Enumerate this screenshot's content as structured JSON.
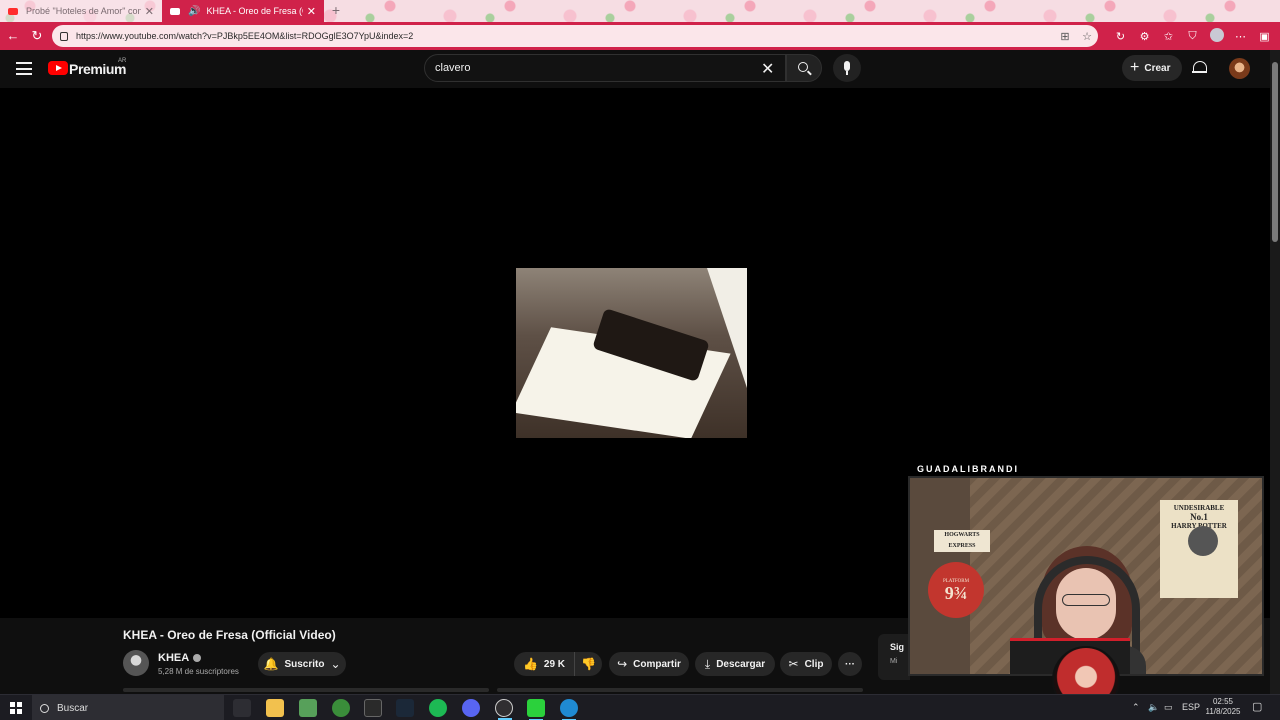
{
  "browser": {
    "tabs": [
      {
        "title": "Probé \"Hoteles de Amor\" con Pe",
        "active": false
      },
      {
        "title": "KHEA - Oreo de Fresa (Offic",
        "active": true
      }
    ],
    "new_tab": "+",
    "url": "https://www.youtube.com/watch?v=PJBkp5EE4OM&list=RDOGglE3O7YpU&index=2",
    "accent": "#d0224a"
  },
  "youtube": {
    "logo_text": "Premium",
    "country": "AR",
    "search_value": "clavero",
    "create_label": "Crear"
  },
  "video": {
    "title": "KHEA - Oreo de Fresa (Official Video)",
    "channel": "KHEA",
    "subscribers": "5,28 M de suscriptores",
    "subscribed_label": "Suscrito",
    "likes": "29 K",
    "share_label": "Compartir",
    "download_label": "Descargar",
    "clip_label": "Clip",
    "more_label": "···"
  },
  "sidebar_preview": {
    "title": "Sig",
    "subtitle": "Mi"
  },
  "overlay": {
    "streamer": "GUADALIBRANDI",
    "sign_text": "HOGWARTS EXPRESS",
    "platform_label": "PLATFORM",
    "platform_number": "9¾",
    "poster_top": "UNDESIRABLE",
    "poster_number": "No.1",
    "poster_name": "HARRY POTTER"
  },
  "taskbar": {
    "search_placeholder": "Buscar",
    "language": "ESP",
    "time": "02:55",
    "date": "11/8/2025",
    "apps": [
      "file-explorer-icon",
      "minecraft-icon",
      "xbox-icon",
      "epic-games-icon",
      "steam-icon",
      "spotify-icon",
      "discord-icon",
      "obs-icon",
      "camera-app-icon",
      "edge-icon"
    ]
  }
}
